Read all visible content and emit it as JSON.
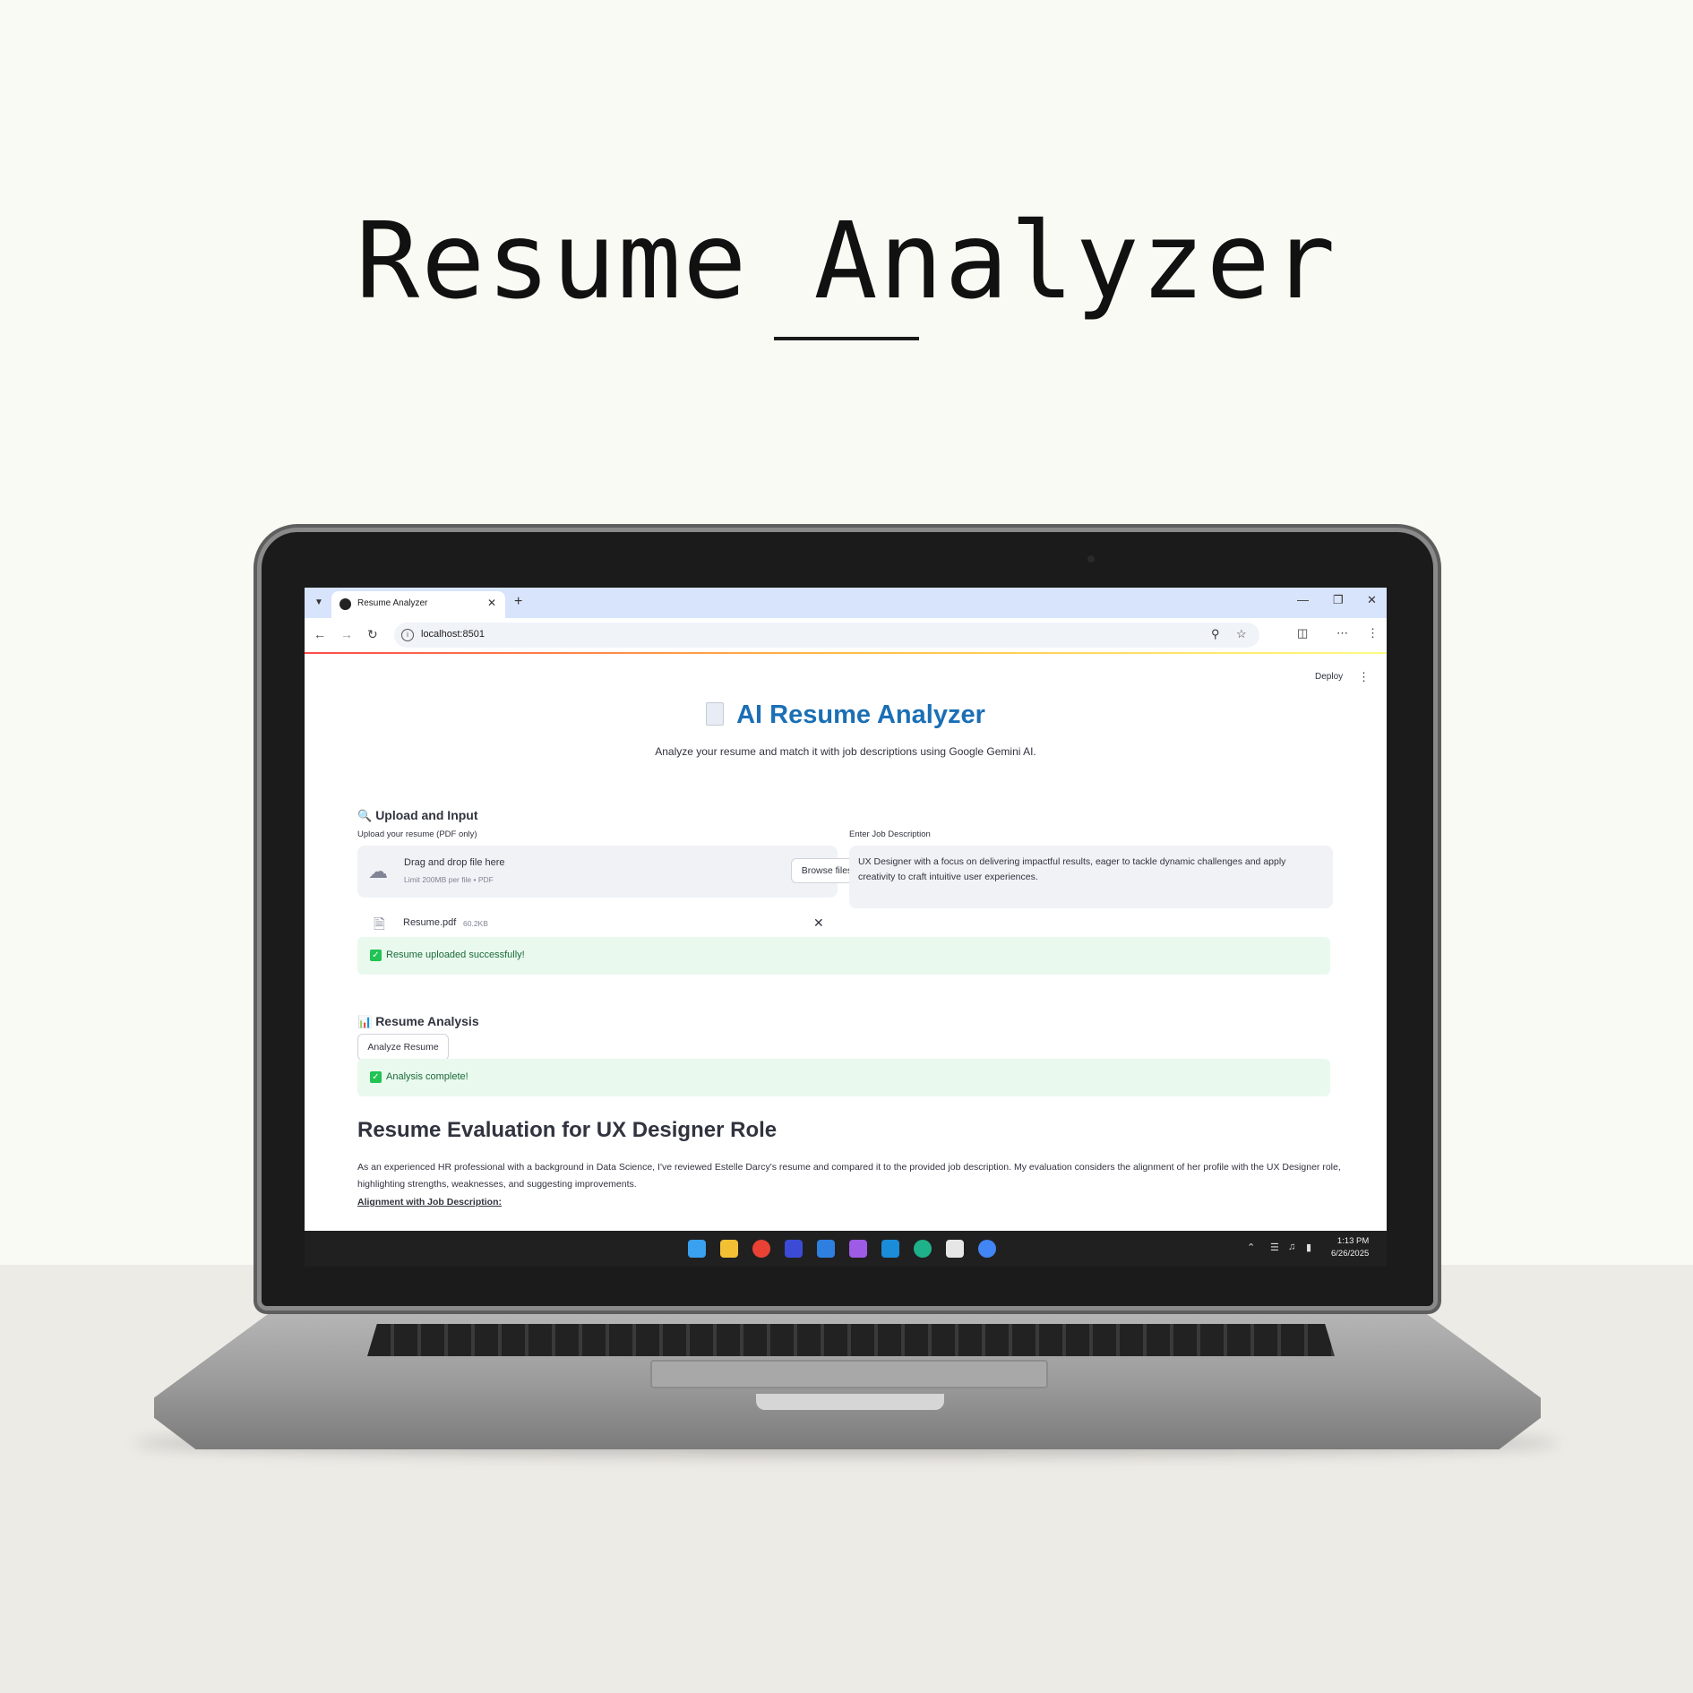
{
  "hero": {
    "title": "Resume Analyzer"
  },
  "browser": {
    "tab_title": "Resume Analyzer",
    "new_tab": "+",
    "url": "localhost:8501",
    "win_minimize": "—",
    "win_restore": "❐",
    "win_close": "✕"
  },
  "app": {
    "deploy_label": "Deploy",
    "title": "AI Resume Analyzer",
    "subtitle": "Analyze your resume and match it with job descriptions using Google Gemini AI.",
    "upload_section": {
      "heading": "Upload and Input",
      "upload_label": "Upload your resume (PDF only)",
      "dropzone_main": "Drag and drop file here",
      "dropzone_sub": "Limit 200MB per file • PDF",
      "browse_label": "Browse files",
      "file_name": "Resume.pdf",
      "file_size": "60.2KB",
      "jd_label": "Enter Job Description",
      "jd_value": "UX Designer with a focus on delivering impactful results, eager to tackle dynamic challenges and apply creativity to craft intuitive user experiences.",
      "success_message": "Resume uploaded successfully!"
    },
    "analysis_section": {
      "heading": "Resume Analysis",
      "analyze_label": "Analyze Resume",
      "complete_message": "Analysis complete!"
    },
    "evaluation": {
      "heading": "Resume Evaluation for UX Designer Role",
      "paragraph": "As an experienced HR professional with a background in Data Science, I've reviewed Estelle Darcy's resume and compared it to the provided job description. My evaluation considers the alignment of her profile with the UX Designer role, highlighting strengths, weaknesses, and suggesting improvements.",
      "subheading": "Alignment with Job Description:"
    }
  },
  "taskbar": {
    "time": "1:13 PM",
    "date": "6/26/2025"
  },
  "colors": {
    "accent_blue": "#1b6fb5",
    "success_bg": "#e9f9ee",
    "success_icon": "#21c354"
  }
}
